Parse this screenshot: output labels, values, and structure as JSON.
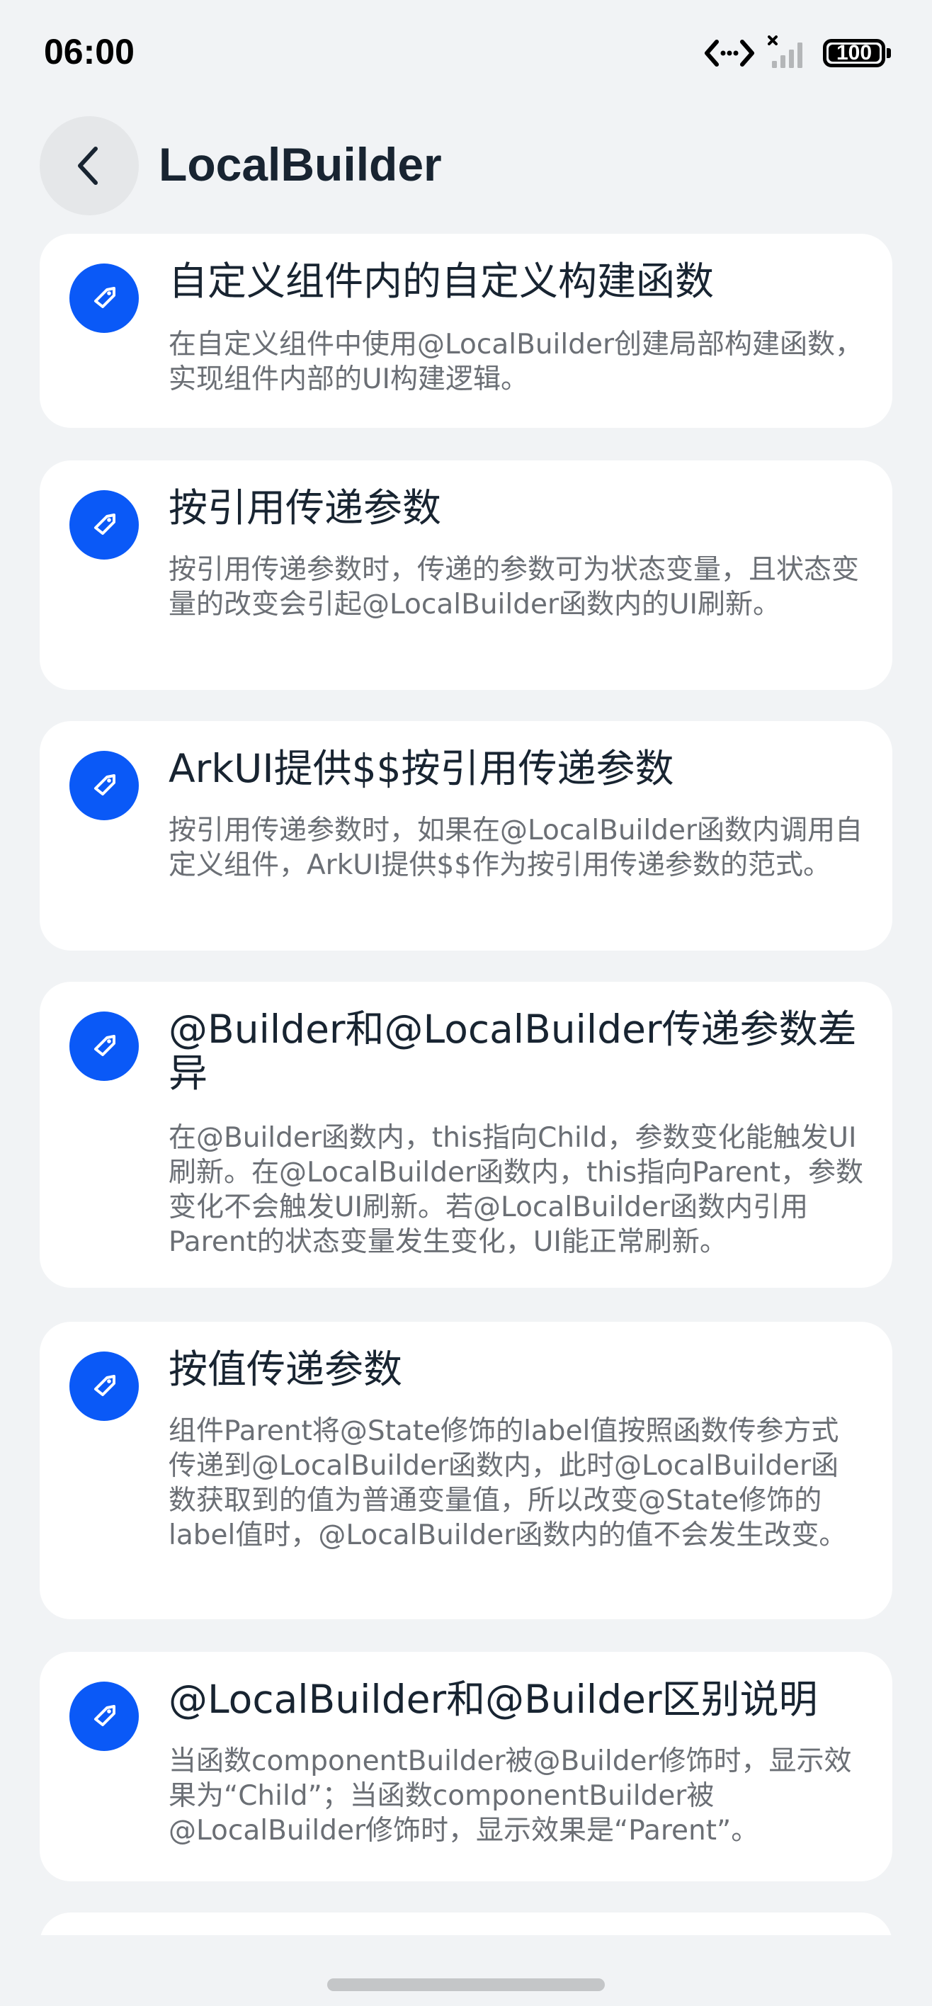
{
  "status_bar": {
    "time": "06:00",
    "battery": "100"
  },
  "header": {
    "title": "LocalBuilder"
  },
  "accent_color": "#0a59f7",
  "cards": [
    {
      "icon": "tag-icon",
      "title": "自定义组件内的自定义构建函数",
      "desc": "在自定义组件中使用@LocalBuilder创建局部构建函数，实现组件内部的UI构建逻辑。"
    },
    {
      "icon": "tag-icon",
      "title": "按引用传递参数",
      "desc": "按引用传递参数时，传递的参数可为状态变量，且状态变量的改变会引起@LocalBuilder函数内的UI刷新。"
    },
    {
      "icon": "tag-icon",
      "title": "ArkUI提供$$按引用传递参数",
      "desc": "按引用传递参数时，如果在@LocalBuilder函数内调用自定义组件，ArkUI提供$$作为按引用传递参数的范式。"
    },
    {
      "icon": "tag-icon",
      "title": "@Builder和@LocalBuilder传递参数差异",
      "desc": "在@Builder函数内，this指向Child，参数变化能触发UI刷新。在@LocalBuilder函数内，this指向Parent，参数变化不会触发UI刷新。若@LocalBuilder函数内引用Parent的状态变量发生变化，UI能正常刷新。"
    },
    {
      "icon": "tag-icon",
      "title": "按值传递参数",
      "desc": "组件Parent将@State修饰的label值按照函数传参方式传递到@LocalBuilder函数内，此时@LocalBuilder函数获取到的值为普通变量值，所以改变@State修饰的label值时，@LocalBuilder函数内的值不会发生改变。"
    },
    {
      "icon": "tag-icon",
      "title": "@LocalBuilder和@Builder区别说明",
      "desc": "当函数componentBuilder被@Builder修饰时，显示效果为“Child”；当函数componentBuilder被@LocalBuilder修饰时，显示效果是“Parent”。"
    }
  ]
}
